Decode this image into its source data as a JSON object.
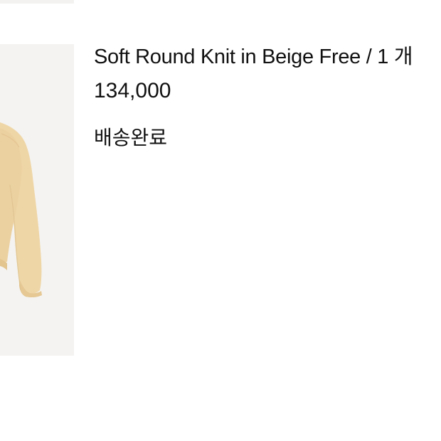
{
  "order_item": {
    "name": "Soft Round Knit in Beige Free / 1 개",
    "price": "134,000",
    "status": "배송완료",
    "thumbnail_icon": "beige-knit-sweater-image"
  },
  "colors": {
    "background": "#ffffff",
    "thumbnail_bg": "#f4f3f1",
    "knit_beige": "#efd6a7",
    "text": "#111111"
  }
}
